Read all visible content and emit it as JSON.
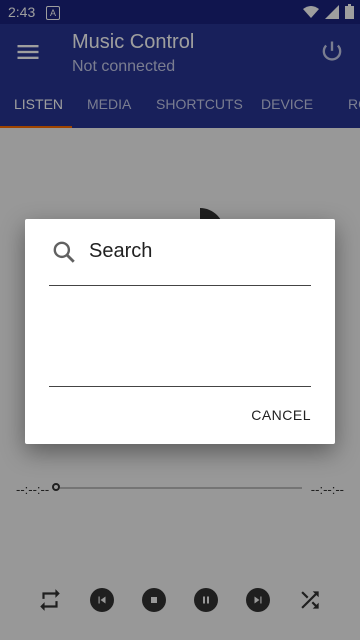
{
  "status_bar": {
    "time": "2:43",
    "notification_icon": "A",
    "icons": [
      "wifi-icon",
      "signal-icon",
      "battery-icon"
    ]
  },
  "app_bar": {
    "title": "Music Control",
    "subtitle": "Not connected",
    "menu_icon": "menu-icon",
    "power_icon": "power-icon"
  },
  "tabs": [
    {
      "label": "LISTEN"
    },
    {
      "label": "MEDIA"
    },
    {
      "label": "SHORTCUTS"
    },
    {
      "label": "DEVICE"
    },
    {
      "label": "RO"
    }
  ],
  "player": {
    "elapsed": "--:--:--",
    "remaining": "--:--:--",
    "controls": [
      "repeat-icon",
      "skip-previous-icon",
      "stop-icon",
      "pause-icon",
      "skip-next-icon",
      "shuffle-icon"
    ]
  },
  "dialog": {
    "title": "Search",
    "cancel_label": "CANCEL",
    "icon": "search-icon"
  },
  "colors": {
    "appbar": "#283593",
    "statusbar": "#1a237e",
    "tab_indicator": "#ff6f00"
  }
}
